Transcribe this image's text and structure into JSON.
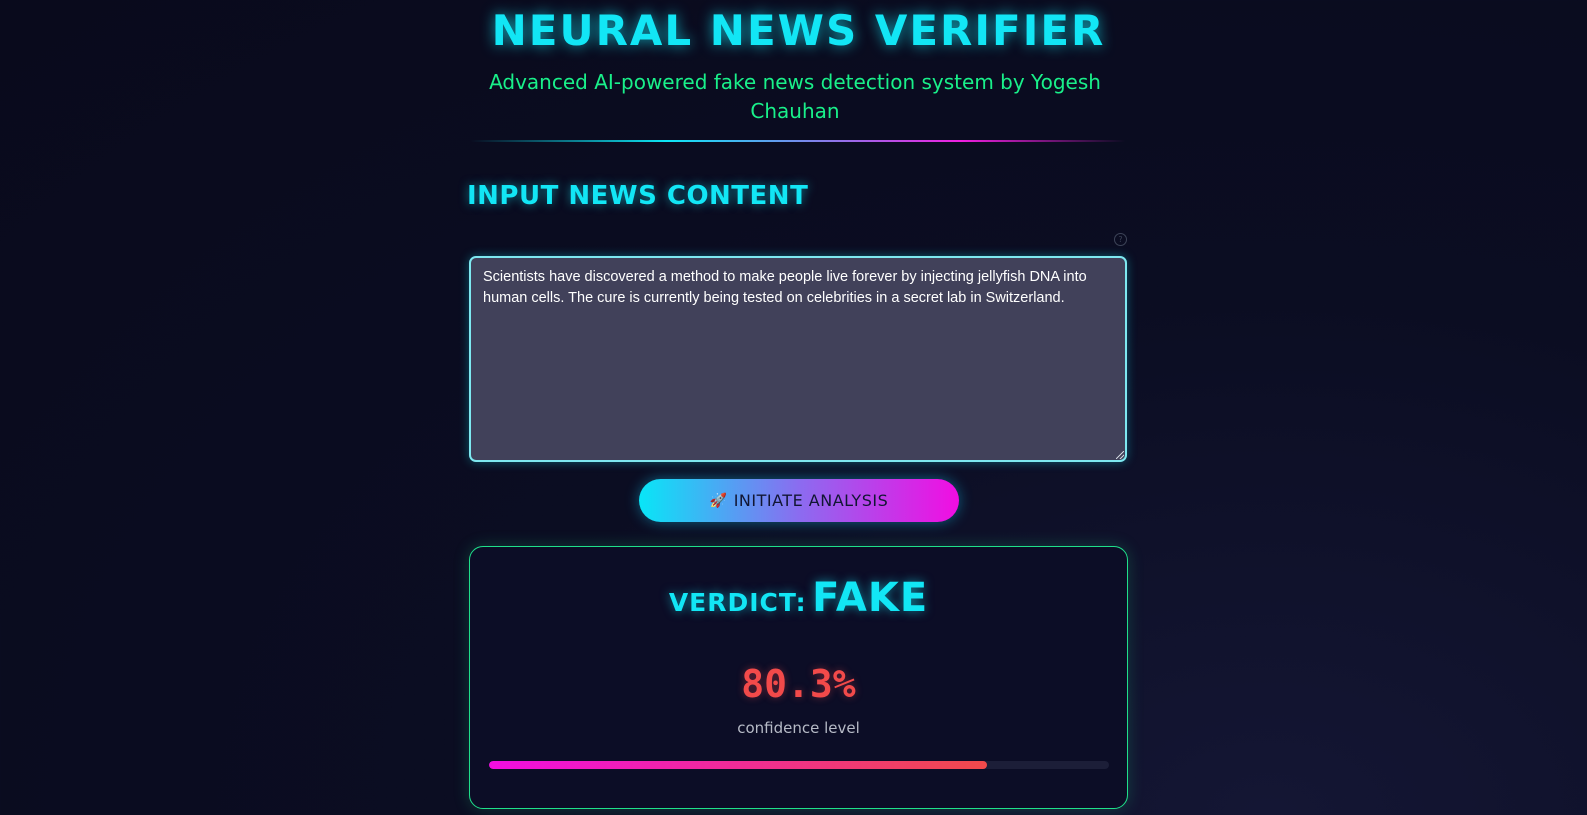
{
  "header": {
    "title": "NEURAL NEWS VERIFIER",
    "subtitle": "Advanced AI-powered fake news detection system by Yogesh Chauhan"
  },
  "input_section": {
    "heading": "INPUT NEWS CONTENT",
    "help_icon": "question-circle-icon",
    "news_text": "Scientists have discovered a method to make people live forever by injecting jellyfish DNA into human cells. The cure is currently being tested on celebrities in a secret lab in Switzerland."
  },
  "analyze_button": {
    "icon": "rocket-icon",
    "label": "INITIATE ANALYSIS"
  },
  "result": {
    "verdict_label": "VERDICT:",
    "verdict_value": "FAKE",
    "confidence_text": "80.3%",
    "confidence_percent": 80.3,
    "confidence_label": "confidence level"
  },
  "colors": {
    "accent_cyan": "#12e6f5",
    "accent_magenta": "#f20de2",
    "accent_green": "#19f08a",
    "fake_red": "#f24a4a",
    "background": "#0b0d22",
    "textarea_bg": "#41415a"
  }
}
